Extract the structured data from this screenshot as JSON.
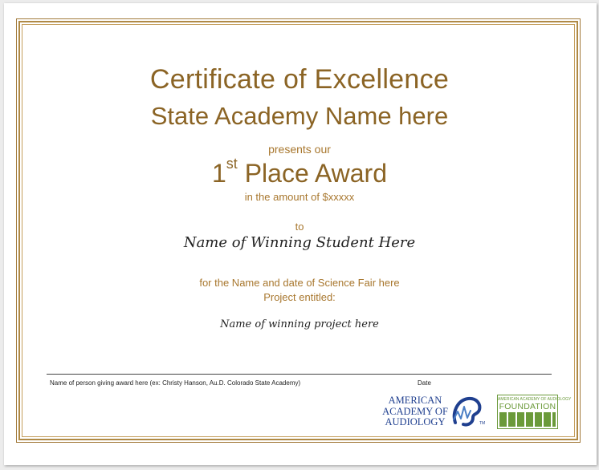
{
  "certificate": {
    "title": "Certificate of Excellence",
    "academy_name": "State Academy Name here",
    "presents_line": "presents our",
    "award_ordinal_number": "1",
    "award_ordinal_suffix": "st",
    "award_name": "Place Award",
    "amount_line": "in the amount of $xxxxx",
    "to_line": "to",
    "student_name": "Name of Winning Student Here",
    "fair_line": "for the Name and date of Science Fair here",
    "project_intro": "Project entitled:",
    "project_name": "Name of winning project here"
  },
  "signature": {
    "presenter_label": "Name of person giving award here (ex: Christy Hanson, Au.D. Colorado State Academy)",
    "date_label": "Date"
  },
  "logos": {
    "aaa": {
      "icon": "american-academy-of-audiology-logo",
      "line1": "AMERICAN",
      "line2": "ACADEMY OF",
      "line3": "AUDIOLOGY",
      "trademark": "TM",
      "color": "#1f3f8f"
    },
    "foundation": {
      "icon": "foundation-logo",
      "small_text": "AMERICAN ACADEMY OF AUDIOLOGY",
      "word": "FOUNDATION",
      "color": "#6b9a3a"
    }
  },
  "colors": {
    "heading": "#8b6425",
    "body_gold": "#a8772e",
    "border": "#b08a46"
  }
}
